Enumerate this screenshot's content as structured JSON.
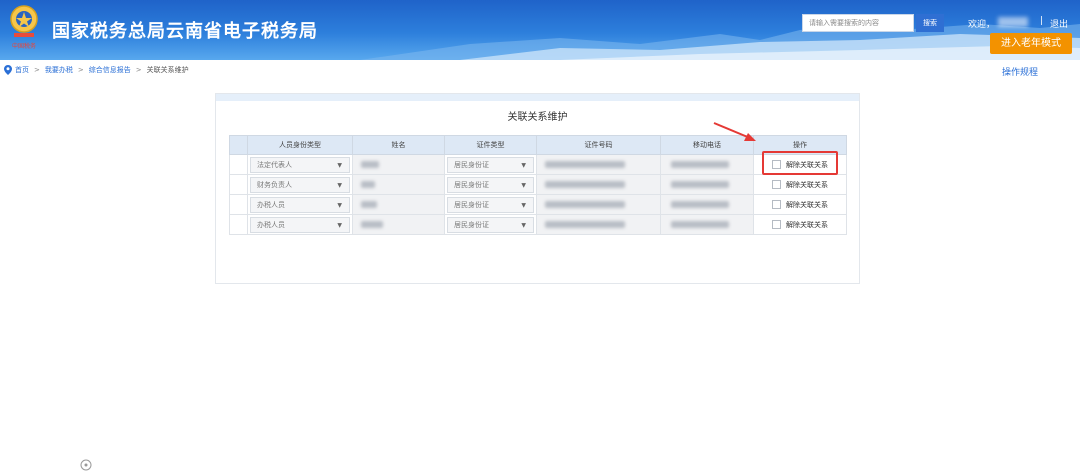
{
  "header": {
    "title": "国家税务总局云南省电子税务局",
    "search_placeholder": "请输入需要搜索的内容",
    "search_button": "搜索",
    "welcome": "欢迎，",
    "separator": "|",
    "logout": "退出",
    "elder_mode": "进入老年模式",
    "emblem_icon": "tax-emblem-icon",
    "emblem_caption": "中国税务"
  },
  "breadcrumb": {
    "icon": "location-pin-icon",
    "separator": ">",
    "items": [
      "首页",
      "我要办税",
      "综合信息报告",
      "关联关系维护"
    ]
  },
  "help_link": "操作规程",
  "panel": {
    "title": "关联关系维护",
    "columns": [
      "人员身份类型",
      "姓名",
      "证件类型",
      "证件号码",
      "移动电话",
      "操作"
    ],
    "rows": [
      {
        "role": "法定代表人",
        "id_type": "居民身份证",
        "action": "解除关联关系"
      },
      {
        "role": "财务负责人",
        "id_type": "居民身份证",
        "action": "解除关联关系"
      },
      {
        "role": "办税人员",
        "id_type": "居民身份证",
        "action": "解除关联关系"
      },
      {
        "role": "办税人员",
        "id_type": "居民身份证",
        "action": "解除关联关系"
      }
    ]
  },
  "annotation": {
    "highlight_color": "#e53935",
    "arrow_color": "#e53935"
  },
  "colors": {
    "header_blue": "#2d7fdc",
    "link_blue": "#2a6fd6",
    "elder_button": "#f39200",
    "table_header": "#dde8f5"
  }
}
